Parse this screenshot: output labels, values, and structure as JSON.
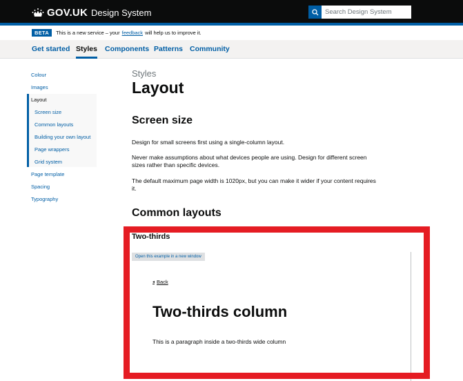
{
  "header": {
    "logo_text": "GOV.UK",
    "product_name": "Design System",
    "search_placeholder": "Search Design System"
  },
  "phase_banner": {
    "tag": "BETA",
    "text_before": "This is a new service – your",
    "link": "feedback",
    "text_after": "will help us to improve it."
  },
  "nav": {
    "items": [
      "Get started",
      "Styles",
      "Components",
      "Patterns",
      "Community"
    ],
    "active": "Styles"
  },
  "sidebar": {
    "items": [
      {
        "label": "Colour"
      },
      {
        "label": "Images"
      },
      {
        "label": "Layout"
      },
      {
        "label": "Screen size"
      },
      {
        "label": "Common layouts"
      },
      {
        "label": "Building your own layout"
      },
      {
        "label": "Page wrappers"
      },
      {
        "label": "Grid system"
      },
      {
        "label": "Page template"
      },
      {
        "label": "Spacing"
      },
      {
        "label": "Typography"
      }
    ]
  },
  "main": {
    "caption": "Styles",
    "title": "Layout",
    "section1": {
      "heading": "Screen size",
      "p1": "Design for small screens first using a single-column layout.",
      "p2": "Never make assumptions about what devices people are using. Design for different screen sizes rather than specific devices.",
      "p3": "The default maximum page width is 1020px, but you can make it wider if your content requires it."
    },
    "section2": {
      "heading": "Common layouts",
      "example_title": "Two-thirds",
      "open_link": "Open this example in a new window",
      "example": {
        "back_link": "Back",
        "heading": "Two-thirds column",
        "paragraph": "This is a paragraph inside a two-thirds wide column"
      }
    }
  },
  "colors": {
    "header_bg": "#0b0c0c",
    "brand_blue": "#005ea5",
    "highlight_red": "#e51c23"
  }
}
